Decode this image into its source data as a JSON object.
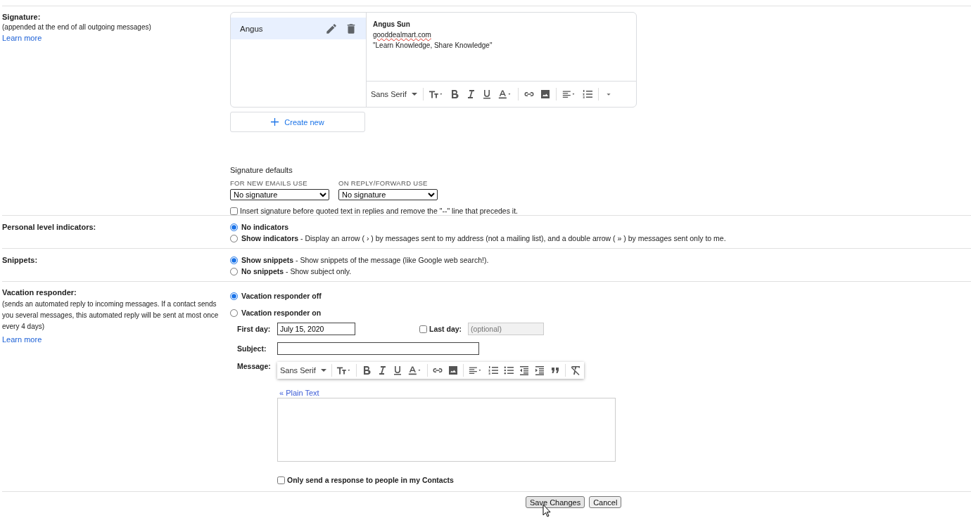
{
  "signature": {
    "title": "Signature:",
    "note": "(appended at the end of all outgoing messages)",
    "learn_more": "Learn more",
    "list": [
      {
        "name": "Angus",
        "selected": true
      }
    ],
    "editor_lines": [
      {
        "text": "Angus Sun",
        "kind": "bold"
      },
      {
        "text": "gooddealmart.com",
        "kind": "misspelled"
      },
      {
        "text": "\"Learn Knowledge, Share Knowledge\"",
        "kind": "plain"
      }
    ],
    "font": "Sans Serif",
    "create_new": "Create new",
    "defaults_title": "Signature defaults",
    "new_label": "FOR NEW EMAILS USE",
    "new_value": "No signature",
    "reply_label": "ON REPLY/FORWARD USE",
    "reply_value": "No signature",
    "insert_before": {
      "label": "Insert signature before quoted text in replies and remove the \"--\" line that precedes it.",
      "checked": false
    }
  },
  "indicators": {
    "title": "Personal level indicators:",
    "options": [
      {
        "label": "No indicators",
        "selected": true
      },
      {
        "label": "Show indicators",
        "description": " - Display an arrow ( › ) by messages sent to my address (not a mailing list), and a double arrow ( » ) by messages sent only to me.",
        "selected": false
      }
    ]
  },
  "snippets": {
    "title": "Snippets:",
    "options": [
      {
        "label": "Show snippets",
        "description": " - Show snippets of the message (like Google web search!).",
        "selected": true
      },
      {
        "label": "No snippets",
        "description": " - Show subject only.",
        "selected": false
      }
    ]
  },
  "vacation": {
    "title": "Vacation responder:",
    "note": "(sends an automated reply to incoming messages. If a contact sends you several messages, this automated reply will be sent at most once every 4 days)",
    "learn_more": "Learn more",
    "options": [
      {
        "label": "Vacation responder off",
        "selected": true
      },
      {
        "label": "Vacation responder on",
        "selected": false
      }
    ],
    "first_day_label": "First day:",
    "first_day_value": "July 15, 2020",
    "last_day": {
      "label": "Last day:",
      "checked": false,
      "placeholder": "(optional)"
    },
    "subject_label": "Subject:",
    "message_label": "Message:",
    "font": "Sans Serif",
    "plain_text": "« Plain Text",
    "contacts_only": {
      "label": "Only send a response to people in my Contacts",
      "checked": false
    }
  },
  "buttons": [
    {
      "label": "Save Changes",
      "kind": "save"
    },
    {
      "label": "Cancel",
      "kind": "cancel"
    }
  ]
}
